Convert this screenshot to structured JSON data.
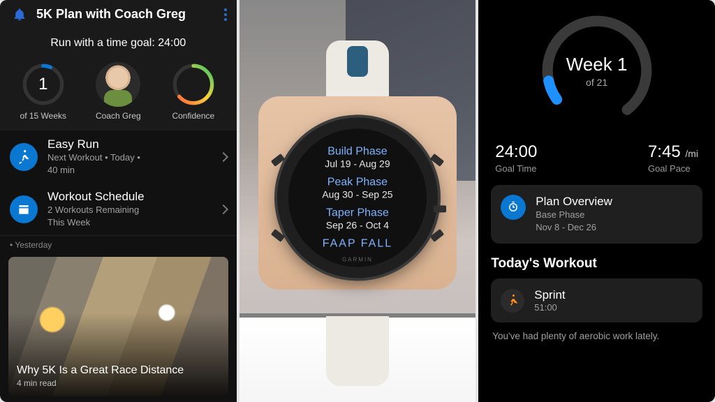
{
  "left": {
    "header_title": "5K Plan with Coach Greg",
    "goal_line": "Run with a time goal: 24:00",
    "week": {
      "num": "1",
      "label": "of 15 Weeks"
    },
    "coach_label": "Coach Greg",
    "confidence_label": "Confidence",
    "rows": [
      {
        "title": "Easy Run",
        "sub": "Next Workout  •  Today  •\n40 min"
      },
      {
        "title": "Workout Schedule",
        "sub": "2 Workouts Remaining\nThis Week"
      }
    ],
    "divider": "Yesterday",
    "article": {
      "title": "Why 5K Is a Great Race Distance",
      "read": "4 min read"
    }
  },
  "watch": {
    "phases": [
      {
        "name": "Build Phase",
        "dates": "Jul 19 - Aug 29"
      },
      {
        "name": "Peak Phase",
        "dates": "Aug 30 - Sep 25"
      },
      {
        "name": "Taper Phase",
        "dates": "Sep 26 - Oct 4"
      }
    ],
    "cutoff": "FAAP FALL",
    "brand": "GARMIN"
  },
  "right": {
    "week_label": "Week 1",
    "week_of": "of 21",
    "goal_time": "24:00",
    "goal_time_label": "Goal Time",
    "goal_pace": "7:45",
    "goal_pace_unit": "/mi",
    "goal_pace_label": "Goal Pace",
    "overview": {
      "title": "Plan Overview",
      "phase": "Base Phase",
      "dates": "Nov 8 - Dec 26"
    },
    "today_title": "Today's Workout",
    "workout": {
      "name": "Sprint",
      "duration": "51:00"
    },
    "note": "You've had plenty of aerobic work lately."
  },
  "colors": {
    "accent": "#0a78d1",
    "confidence_gradient": [
      "#ff5a3c",
      "#ffd23a",
      "#33c46a"
    ]
  }
}
